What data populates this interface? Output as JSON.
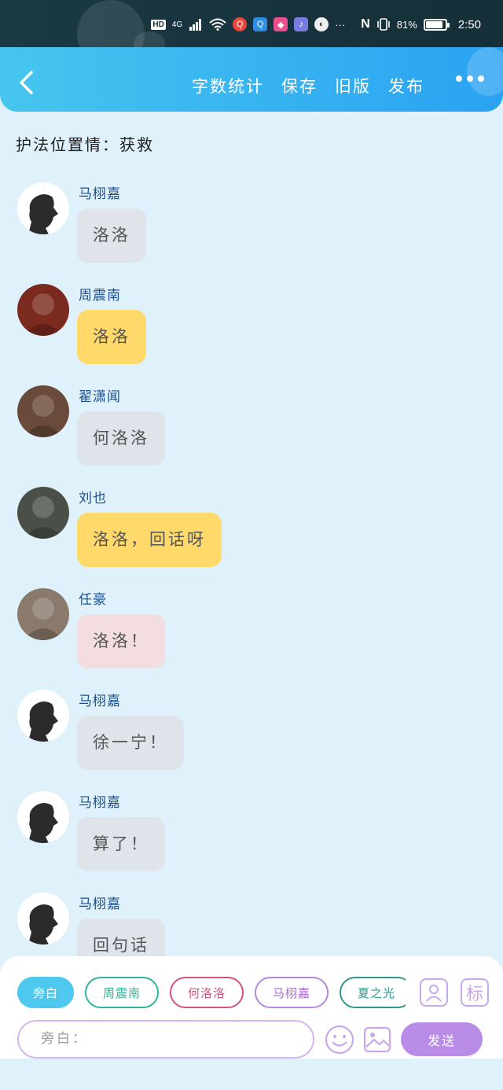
{
  "status_bar": {
    "hd": "HD",
    "network": "4G",
    "battery_percent": "81%",
    "time": "2:50",
    "more_dots": "···",
    "nfc": "N"
  },
  "header": {
    "actions": [
      "字数统计",
      "保存",
      "旧版",
      "发布"
    ]
  },
  "scene_title": "护法位置情：获救",
  "messages": [
    {
      "name": "马栩嘉",
      "text": "洛洛",
      "bubble_color": "#dfe3ea",
      "avatar_color": "#ffffff"
    },
    {
      "name": "周震南",
      "text": "洛洛",
      "bubble_color": "#ffd96a",
      "avatar_color": "#7a2a1e"
    },
    {
      "name": "翟潇闻",
      "text": "何洛洛",
      "bubble_color": "#dfe3ea",
      "avatar_color": "#6a4a3a"
    },
    {
      "name": "刘也",
      "text": "洛洛，回话呀",
      "bubble_color": "#ffd96a",
      "avatar_color": "#4a5048"
    },
    {
      "name": "任豪",
      "text": "洛洛！",
      "bubble_color": "#f3dde0",
      "avatar_color": "#8a7a6c"
    },
    {
      "name": "马栩嘉",
      "text": "徐一宁！",
      "bubble_color": "#dfe3ea",
      "avatar_color": "#ffffff"
    },
    {
      "name": "马栩嘉",
      "text": "算了！",
      "bubble_color": "#dfe3ea",
      "avatar_color": "#ffffff"
    },
    {
      "name": "马栩嘉",
      "text": "回句话",
      "bubble_color": "#dfe3ea",
      "avatar_color": "#ffffff"
    }
  ],
  "roles": [
    {
      "label": "旁白",
      "color": "#ffffff",
      "border": "#4ec8ee",
      "bg": "#4ec8ee"
    },
    {
      "label": "周震南",
      "color": "#2fb39a",
      "border": "#2fb39a",
      "bg": "#ffffff"
    },
    {
      "label": "何洛洛",
      "color": "#d5537a",
      "border": "#d5537a",
      "bg": "#ffffff"
    },
    {
      "label": "马栩嘉",
      "color": "#a36ad0",
      "border": "#b48ad8",
      "bg": "#ffffff"
    },
    {
      "label": "夏之光",
      "color": "#2f9a8a",
      "border": "#2f9a8a",
      "bg": "#ffffff"
    }
  ],
  "toolbar": {
    "mark_label": "标",
    "input_placeholder": "旁白：",
    "send_label": "发送"
  },
  "colors": {
    "accent": "#2aa2f2",
    "background": "#dff1fb",
    "send": "#b98ce8"
  }
}
